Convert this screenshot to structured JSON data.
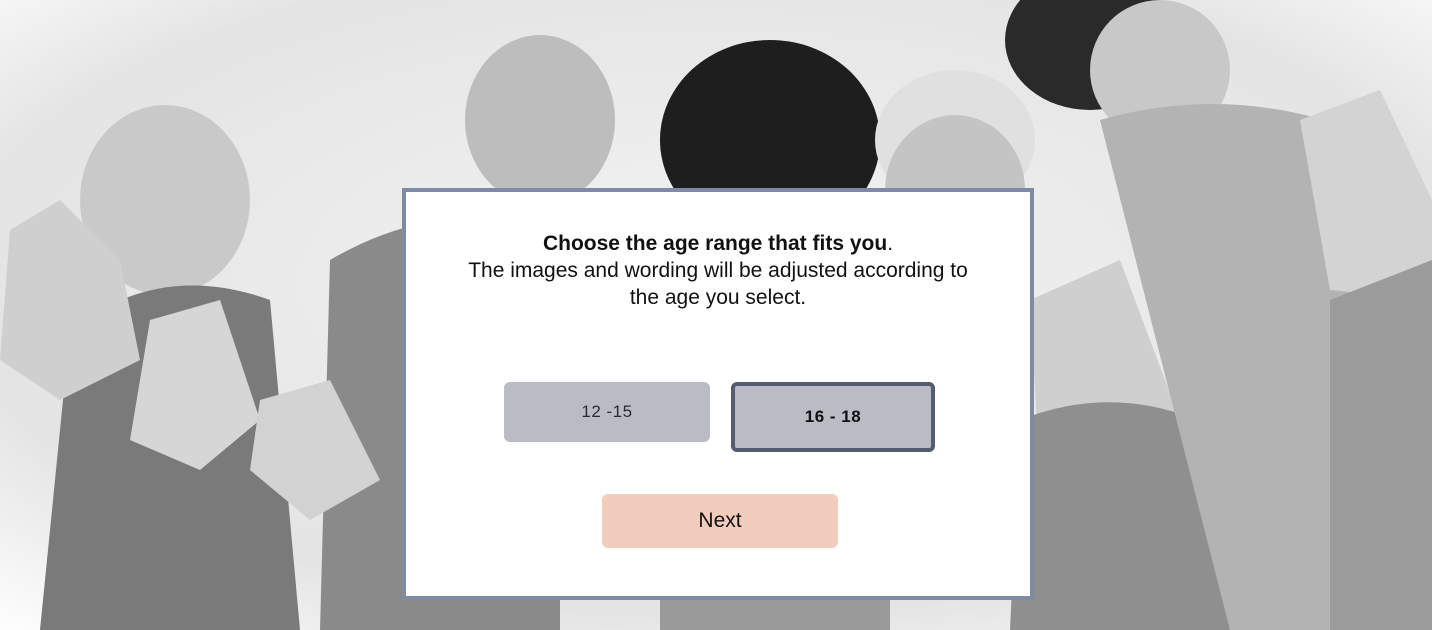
{
  "background": {
    "icon": "teens-photo-background"
  },
  "dialog": {
    "heading_strong": "Choose the age range that fits you",
    "heading_tail": ".",
    "body_line1": "The images and wording will be adjusted according to",
    "body_line2": "the age you select.",
    "options": [
      {
        "label": "12 -15",
        "selected": false
      },
      {
        "label": "16 - 18",
        "selected": true
      }
    ],
    "next_label": "Next"
  },
  "colors": {
    "dialog_border": "#7f8ba3",
    "option_bg": "#b9bcc5",
    "selected_border": "#555b70",
    "next_bg": "#f2cdbd"
  }
}
